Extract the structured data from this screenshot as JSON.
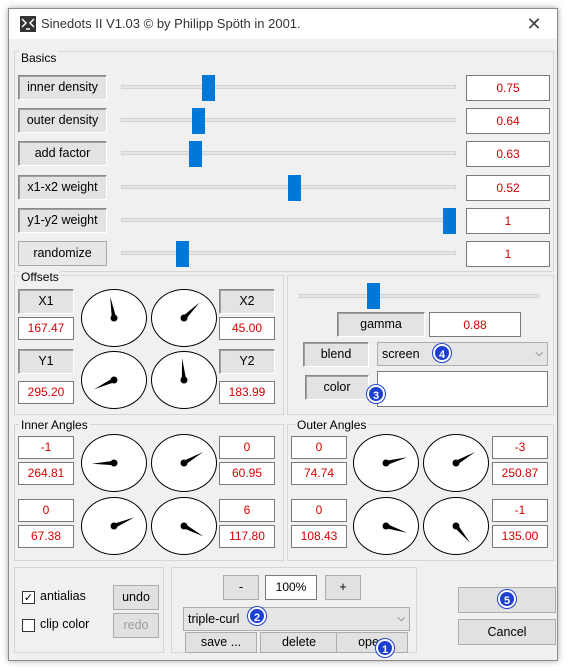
{
  "window": {
    "title": "Sinedots II V1.03 © by Philipp Spöth in 2001.",
    "close": "✕"
  },
  "basics": {
    "label": "Basics",
    "rows": [
      {
        "label": "inner density",
        "value": "0.75",
        "level": 0.25
      },
      {
        "label": "outer density",
        "value": "0.64",
        "level": 0.22
      },
      {
        "label": "add factor",
        "value": "0.63",
        "level": 0.21
      },
      {
        "label": "x1-x2 weight",
        "value": "0.52",
        "level": 0.52
      },
      {
        "label": "y1-y2 weight",
        "value": "1",
        "level": 1.0
      },
      {
        "label": "randomize",
        "value": "1",
        "level": 0.17
      }
    ]
  },
  "offsets": {
    "label": "Offsets",
    "x1": {
      "label": "X1",
      "value": "167.47"
    },
    "x2": {
      "label": "X2",
      "value": "45.00"
    },
    "y1": {
      "label": "Y1",
      "value": "295.20"
    },
    "y2": {
      "label": "Y2",
      "value": "183.99"
    }
  },
  "render": {
    "gamma_label": "gamma",
    "gamma_value": "0.88",
    "gamma_level": 0.3,
    "blend_label": "blend",
    "blend_value": "screen",
    "color_label": "color"
  },
  "inner_angles": {
    "label": "Inner Angles",
    "a": {
      "top": "-1",
      "value": "264.81"
    },
    "b": {
      "top": "0",
      "value": "60.95"
    },
    "c": {
      "top": "0",
      "value": "67.38"
    },
    "d": {
      "top": "6",
      "value": "117.80"
    }
  },
  "outer_angles": {
    "label": "Outer Angles",
    "a": {
      "top": "0",
      "value": "74.74"
    },
    "b": {
      "top": "-3",
      "value": "250.87"
    },
    "c": {
      "top": "0",
      "value": "108.43"
    },
    "d": {
      "top": "-1",
      "value": "135.00"
    }
  },
  "bottom": {
    "antialias": "antialias",
    "clip_color": "clip color",
    "undo": "undo",
    "redo": "redo",
    "minus": "-",
    "zoom": "100%",
    "plus": "+",
    "preset": "triple-curl",
    "save": "save ...",
    "delete": "delete",
    "open": "open",
    "ok": "",
    "cancel": "Cancel"
  },
  "badges": [
    "1",
    "2",
    "3",
    "4",
    "5"
  ],
  "colors": {
    "accent": "#0078d7",
    "value_text": "#d40000",
    "badge": "#1b3fd0"
  }
}
